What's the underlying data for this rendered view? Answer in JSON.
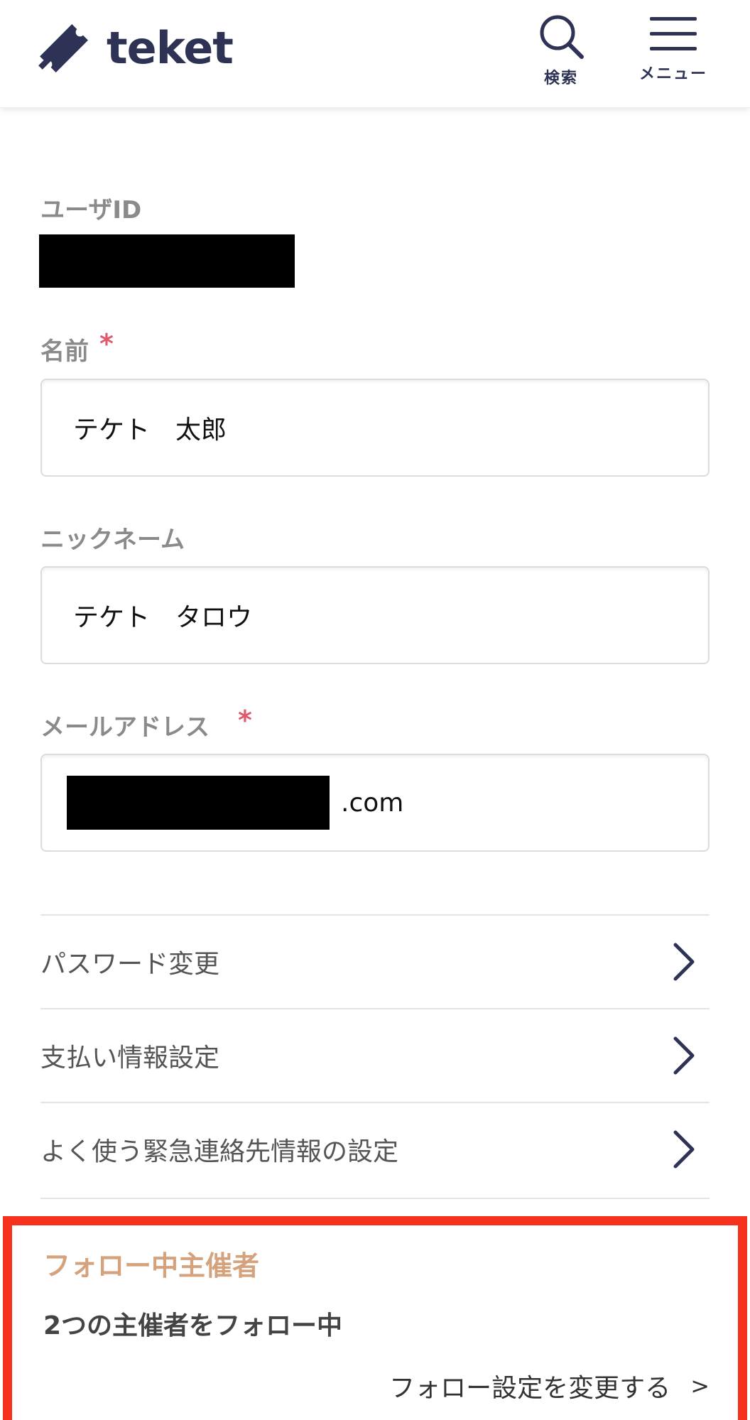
{
  "header": {
    "logo_text": "teket",
    "search_label": "検索",
    "menu_label": "メニュー",
    "brand_color": "#2e3355"
  },
  "user_id": {
    "label": "ユーザID"
  },
  "name": {
    "label": "名前",
    "required_mark": "*",
    "value": "テケト　太郎"
  },
  "nickname": {
    "label": "ニックネーム",
    "value": "テケト　タロウ"
  },
  "email": {
    "label": "メールアドレス",
    "required_mark": "*",
    "value_suffix": ".com"
  },
  "settings_links": [
    {
      "label": "パスワード変更",
      "icon": "chevron-right-icon"
    },
    {
      "label": "支払い情報設定",
      "icon": "chevron-right-icon"
    },
    {
      "label": "よく使う緊急連絡先情報の設定",
      "icon": "chevron-right-icon"
    }
  ],
  "following": {
    "title": "フォロー中主催者",
    "count_text": "2つの主催者をフォロー中",
    "change_link": "フォロー設定を変更する",
    "change_arrow": ">",
    "highlight_color": "#f5311b",
    "title_color": "#d4a27c"
  },
  "colors": {
    "required": "#e05a6e",
    "label": "#8a8a8a"
  }
}
